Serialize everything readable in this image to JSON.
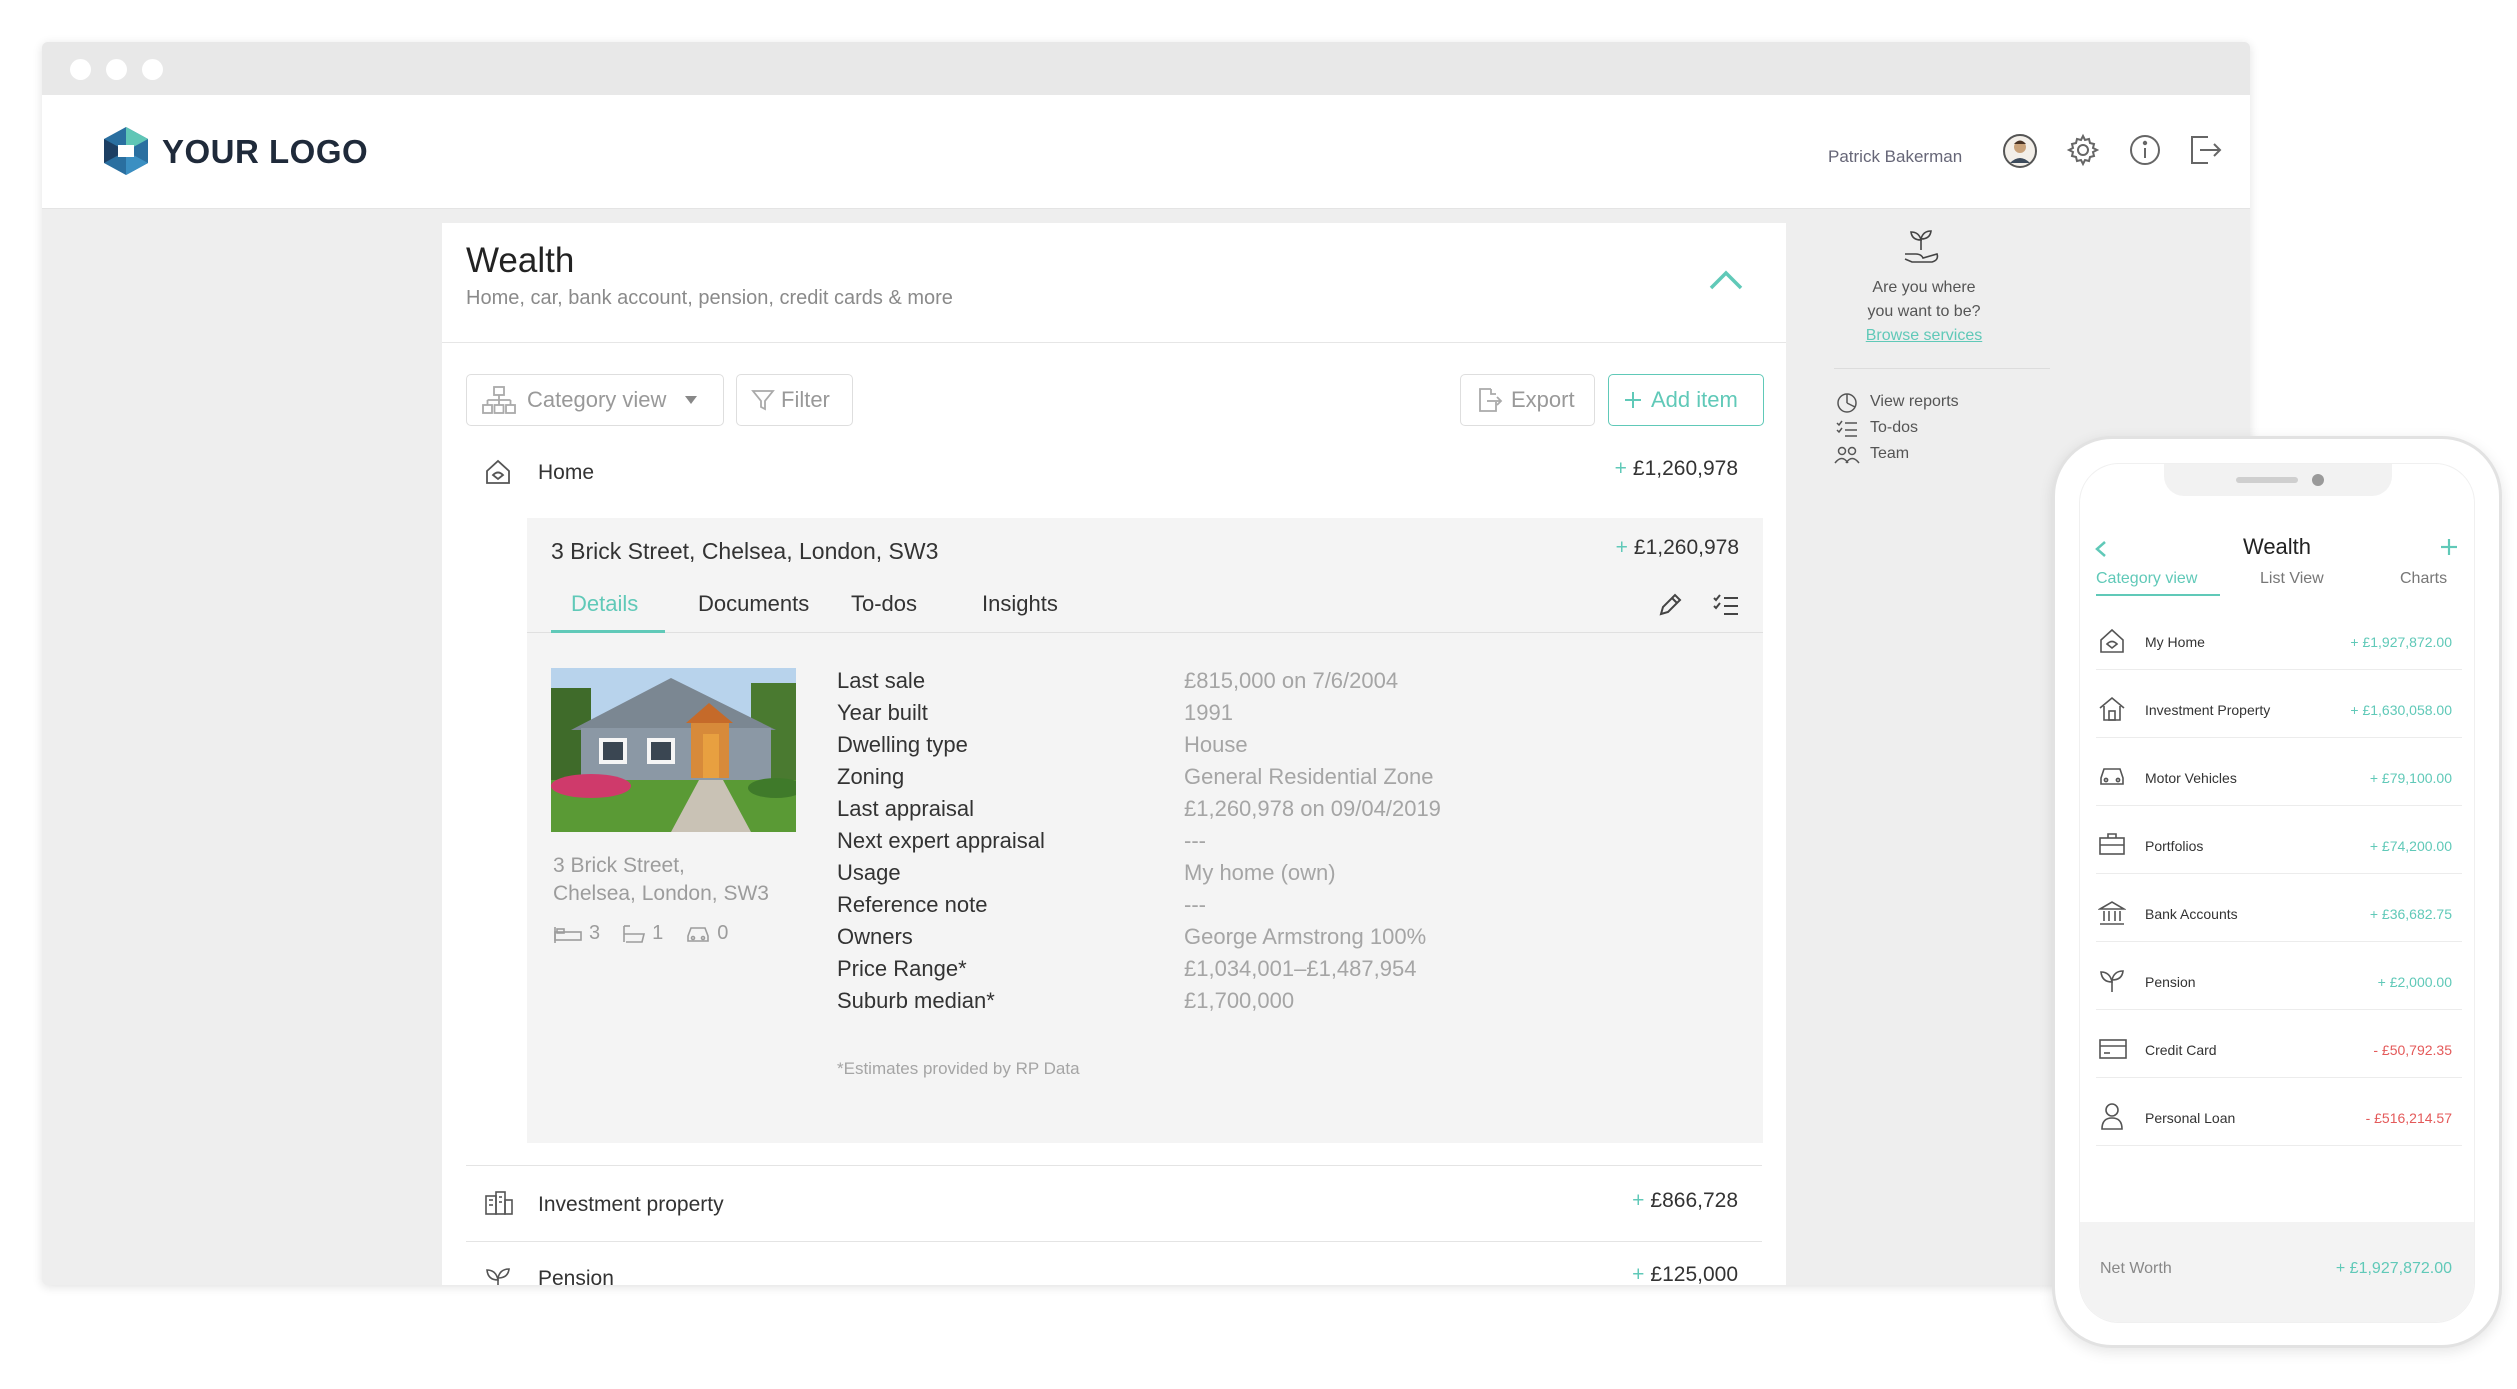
{
  "header": {
    "logo_text": "YOUR LOGO",
    "user_name": "Patrick Bakerman",
    "icons": [
      "avatar",
      "gear-icon",
      "info-icon",
      "logout-icon"
    ]
  },
  "page": {
    "title": "Wealth",
    "subtitle": "Home, car, bank account, pension, credit cards & more"
  },
  "toolbar": {
    "category_view": "Category view",
    "filter": "Filter",
    "export": "Export",
    "add_item": "Add item"
  },
  "home": {
    "label": "Home",
    "value": "£1,260,978",
    "sign": "+"
  },
  "property": {
    "address": "3 Brick Street, Chelsea, London, SW3",
    "value": "£1,260,978",
    "sign": "+",
    "tabs": [
      "Details",
      "Documents",
      "To-dos",
      "Insights"
    ],
    "active_tab": "Details",
    "caption_line1": "3 Brick Street,",
    "caption_line2": "Chelsea, London, SW3",
    "beds": "3",
    "baths": "1",
    "cars": "0",
    "details": [
      {
        "key": "Last sale",
        "value": "£815,000 on 7/6/2004"
      },
      {
        "key": "Year built",
        "value": "1991"
      },
      {
        "key": "Dwelling type",
        "value": "House"
      },
      {
        "key": "Zoning",
        "value": "General Residential Zone"
      },
      {
        "key": "Last appraisal",
        "value": "£1,260,978 on 09/04/2019"
      },
      {
        "key": "Next expert appraisal",
        "value": "---"
      },
      {
        "key": "Usage",
        "value": "My home (own)"
      },
      {
        "key": "Reference note",
        "value": "---"
      },
      {
        "key": "Owners",
        "value": "George Armstrong 100%"
      },
      {
        "key": "Price Range*",
        "value": "£1,034,001–£1,487,954"
      },
      {
        "key": "Suburb median*",
        "value": "£1,700,000"
      }
    ],
    "footnote": "*Estimates provided by RP Data"
  },
  "rows": [
    {
      "label": "Investment property",
      "value": "£866,728",
      "sign": "+"
    },
    {
      "label": "Pension",
      "value": "£125,000",
      "sign": "+"
    }
  ],
  "sidebar": {
    "prompt_line1": "Are you where",
    "prompt_line2": "you want to be?",
    "link": "Browse services",
    "links": [
      "View reports",
      "To-dos",
      "Team"
    ]
  },
  "phone": {
    "title": "Wealth",
    "tabs": [
      "Category view",
      "List View",
      "Charts"
    ],
    "active_tab": "Category view",
    "items": [
      {
        "label": "My Home",
        "value": "+ £1,927,872.00",
        "type": "pos",
        "icon": "home-icon"
      },
      {
        "label": "Investment Property",
        "value": "+ £1,630,058.00",
        "type": "pos",
        "icon": "house-icon"
      },
      {
        "label": "Motor Vehicles",
        "value": "+ £79,100.00",
        "type": "pos",
        "icon": "car-icon"
      },
      {
        "label": "Portfolios",
        "value": "+ £74,200.00",
        "type": "pos",
        "icon": "briefcase-icon"
      },
      {
        "label": "Bank Accounts",
        "value": "+ £36,682.75",
        "type": "pos",
        "icon": "bank-icon"
      },
      {
        "label": "Pension",
        "value": "+ £2,000.00",
        "type": "pos",
        "icon": "plant-icon"
      },
      {
        "label": "Credit Card",
        "value": "- £50,792.35",
        "type": "neg",
        "icon": "credit-card-icon"
      },
      {
        "label": "Personal Loan",
        "value": "- £516,214.57",
        "type": "neg",
        "icon": "person-icon"
      }
    ],
    "footer_label": "Net Worth",
    "footer_value": "+ £1,927,872.00"
  },
  "colors": {
    "accent": "#60c9b8",
    "negative": "#e45a5a"
  }
}
